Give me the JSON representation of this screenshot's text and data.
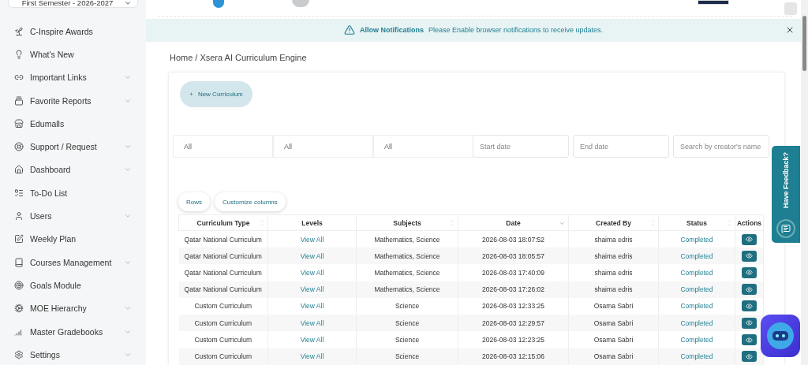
{
  "semester": {
    "value": "First Semester - 2026-2027"
  },
  "sidebar": {
    "items": [
      {
        "label": "C-Inspire Awards",
        "expandable": false
      },
      {
        "label": "What's New",
        "expandable": false
      },
      {
        "label": "Important Links",
        "expandable": true
      },
      {
        "label": "Favorite Reports",
        "expandable": true
      },
      {
        "label": "Edumalls",
        "expandable": false
      },
      {
        "label": "Support / Request",
        "expandable": true
      },
      {
        "label": "Dashboard",
        "expandable": true
      },
      {
        "label": "To-Do List",
        "expandable": false
      },
      {
        "label": "Users",
        "expandable": true
      },
      {
        "label": "Weekly Plan",
        "expandable": false
      },
      {
        "label": "Courses Management",
        "expandable": true
      },
      {
        "label": "Goals Module",
        "expandable": false
      },
      {
        "label": "MOE Hierarchy",
        "expandable": true
      },
      {
        "label": "Master Gradebooks",
        "expandable": true
      },
      {
        "label": "Settings",
        "expandable": true
      }
    ]
  },
  "notification": {
    "title": "Allow Notifications",
    "message": "Please Enable browser notifications to receive updates."
  },
  "breadcrumb": {
    "items": [
      "Home",
      "Xsera AI Curriculum Engine"
    ],
    "separator": "/"
  },
  "new_button": {
    "icon_text": "+",
    "label": "New Curriculum"
  },
  "filters": {
    "selects": [
      "All",
      "All",
      "All"
    ],
    "start_date": {
      "placeholder": "Start date"
    },
    "end_date": {
      "placeholder": "End date"
    },
    "search": {
      "placeholder": "Search by creator's name"
    }
  },
  "table_buttons": [
    "Rows",
    "Customize columns"
  ],
  "table": {
    "columns": [
      {
        "label": "Curriculum Type",
        "sortable": true,
        "sorted": false
      },
      {
        "label": "Levels",
        "sortable": false,
        "sorted": false
      },
      {
        "label": "Subjects",
        "sortable": true,
        "sorted": false
      },
      {
        "label": "Date",
        "sortable": true,
        "sorted": true
      },
      {
        "label": "Created By",
        "sortable": true,
        "sorted": false
      },
      {
        "label": "Status",
        "sortable": true,
        "sorted": false
      },
      {
        "label": "Actions",
        "sortable": false,
        "sorted": false
      }
    ],
    "rows": [
      {
        "type": "Qatar National Curriculum",
        "levels": "View All",
        "subjects": "Mathematics, Science",
        "date": "2026-08-03 18:07:52",
        "created_by": "shaima edris",
        "status": "Completed"
      },
      {
        "type": "Qatar National Curriculum",
        "levels": "View All",
        "subjects": "Mathematics, Science",
        "date": "2026-08-03 18:05:57",
        "created_by": "shaima edris",
        "status": "Completed"
      },
      {
        "type": "Qatar National Curriculum",
        "levels": "View All",
        "subjects": "Mathematics, Science",
        "date": "2026-08-03 17:40:09",
        "created_by": "shaima edris",
        "status": "Completed"
      },
      {
        "type": "Qatar National Curriculum",
        "levels": "View All",
        "subjects": "Mathematics, Science",
        "date": "2026-08-03 17:26:02",
        "created_by": "shaima edris",
        "status": "Completed"
      },
      {
        "type": "Custom Curriculum",
        "levels": "View All",
        "subjects": "Science",
        "date": "2026-08-03 12:33:25",
        "created_by": "Osama Sabri",
        "status": "Completed"
      },
      {
        "type": "Custom Curriculum",
        "levels": "View All",
        "subjects": "Science",
        "date": "2026-08-03 12:29:57",
        "created_by": "Osama Sabri",
        "status": "Completed"
      },
      {
        "type": "Custom Curriculum",
        "levels": "View All",
        "subjects": "Science",
        "date": "2026-08-03 12:23:25",
        "created_by": "Osama Sabri",
        "status": "Completed"
      },
      {
        "type": "Custom Curriculum",
        "levels": "View All",
        "subjects": "Science",
        "date": "2026-08-03 12:15:06",
        "created_by": "Osama Sabri",
        "status": "Completed"
      }
    ]
  },
  "feedback": {
    "label": "Have Feedback?"
  }
}
